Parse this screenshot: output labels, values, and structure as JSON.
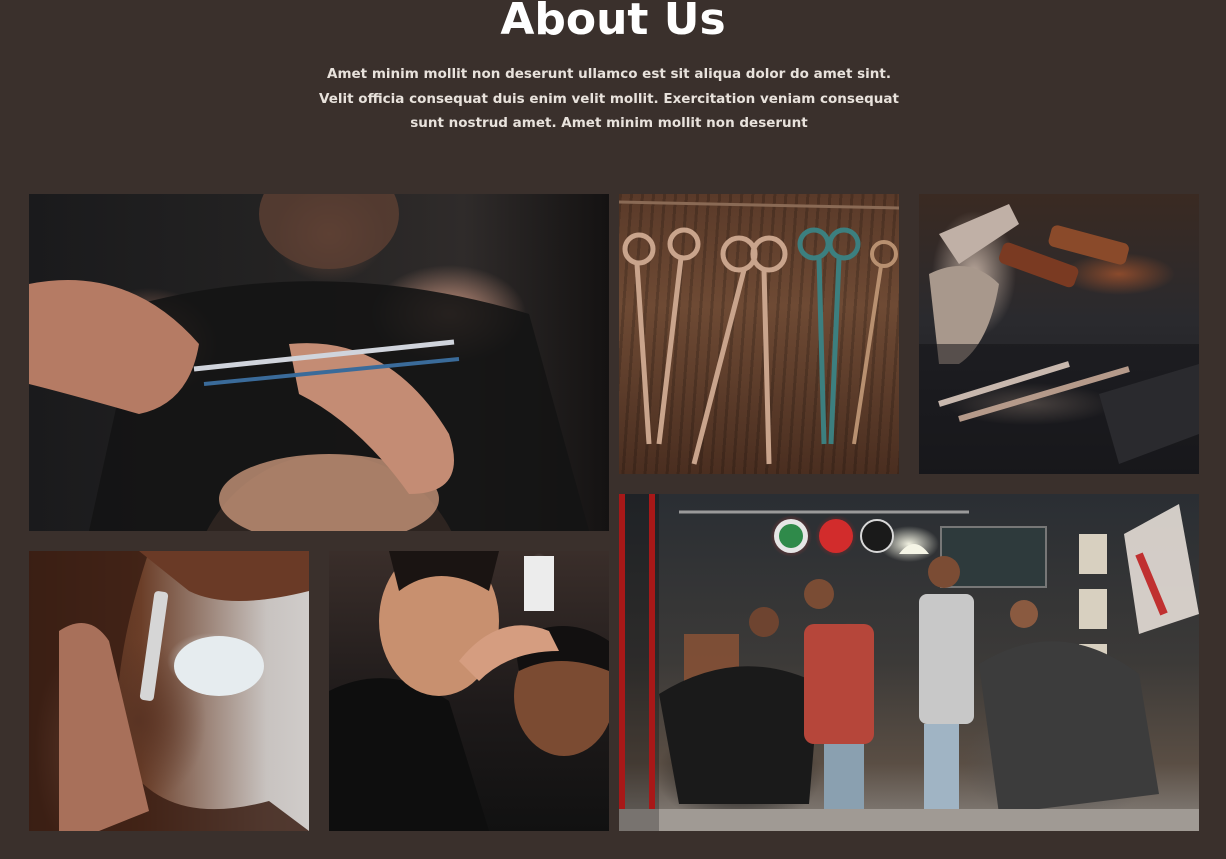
{
  "section": {
    "title": "About Us",
    "intro": "Amet minim mollit non deserunt ullamco est sit aliqua dolor do amet sint. Velit officia consequat duis enim velit mollit. Exercitation veniam consequat sunt nostrud amet. Amet minim mollit non deserunt"
  },
  "colors": {
    "background": "#3a302c",
    "title": "#ffffff",
    "body_text": "#e8e2dc"
  },
  "gallery": {
    "photos": [
      {
        "name": "barber-cutting-hair-photo"
      },
      {
        "name": "scissors-on-wall-photo"
      },
      {
        "name": "shaving-tools-photo"
      },
      {
        "name": "beard-shaving-photo"
      },
      {
        "name": "haircut-from-behind-photo"
      },
      {
        "name": "barbershop-interior-photo"
      }
    ]
  }
}
